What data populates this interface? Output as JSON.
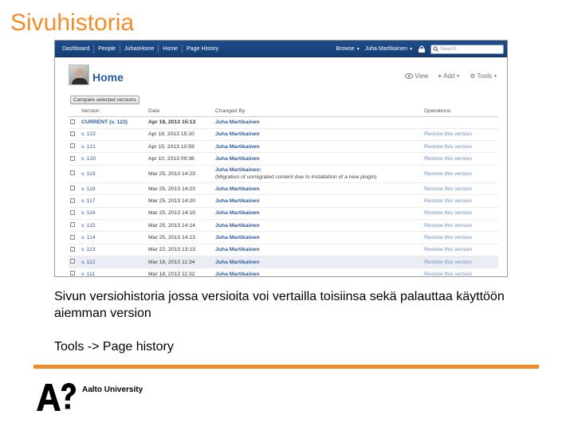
{
  "slide": {
    "title": "Sivuhistoria",
    "caption": "Sivun versiohistoria jossa versioita voi vertailla toisiinsa sekä palauttaa käyttöön aiemman version",
    "path": "Tools -> Page history",
    "accent_color": "#f28c28",
    "logo_text": "Aalto University"
  },
  "wiki": {
    "breadcrumbs": [
      "Dashboard",
      "People",
      "JuhasHome",
      "Home",
      "Page History"
    ],
    "browse": "Browse",
    "user": "Juha Martikainen",
    "search_placeholder": "Search",
    "page_title": "Home",
    "actions": {
      "view": "View",
      "add": "Add",
      "tools": "Tools"
    },
    "compare_button": "Compare selected versions",
    "columns": {
      "version": "Version",
      "date": "Date",
      "changed_by": "Changed By",
      "operations": "Operations"
    },
    "rows": [
      {
        "version": "CURRENT",
        "version_suffix": " (v. 123)",
        "date": "Apr 18, 2013 15:13",
        "by": "Juha Martikainen",
        "op": ""
      },
      {
        "version": "v. 122",
        "date": "Apr 18, 2013 15:10",
        "by": "Juha Martikainen",
        "op": "Restore this version"
      },
      {
        "version": "v. 121",
        "date": "Apr 15, 2013 10:59",
        "by": "Juha Martikainen",
        "op": "Restore this version"
      },
      {
        "version": "v. 120",
        "date": "Apr 10, 2013 09:36",
        "by": "Juha Martikainen",
        "op": "Restore this version"
      },
      {
        "version": "v. 119",
        "date": "Mar 25, 2013 14:23",
        "by": "Juha Martikainen:",
        "note": "(Migration of unmigrated content due to installation of a new plugin)",
        "op": "Restore this version"
      },
      {
        "version": "v. 118",
        "date": "Mar 25, 2013 14:23",
        "by": "Juha Martikainen",
        "op": "Restore this version"
      },
      {
        "version": "v. 117",
        "date": "Mar 25, 2013 14:20",
        "by": "Juha Martikainen",
        "op": "Restore this version"
      },
      {
        "version": "v. 116",
        "date": "Mar 25, 2013 14:19",
        "by": "Juha Martikainen",
        "op": "Restore this version"
      },
      {
        "version": "v. 115",
        "date": "Mar 25, 2013 14:14",
        "by": "Juha Martikainen",
        "op": "Restore this version"
      },
      {
        "version": "v. 114",
        "date": "Mar 25, 2013 14:13",
        "by": "Juha Martikainen",
        "op": "Restore this version"
      },
      {
        "version": "v. 113",
        "date": "Mar 22, 2013 13:13",
        "by": "Juha Martikainen",
        "op": "Restore this version"
      },
      {
        "version": "v. 112",
        "date": "Mar 18, 2013 11:34",
        "by": "Juha Martikainen",
        "op": "Restore this version",
        "highlighted": true
      },
      {
        "version": "v. 111",
        "date": "Mar 18, 2013 11:32",
        "by": "Juha Martikainen",
        "op": "Restore this version"
      }
    ]
  }
}
